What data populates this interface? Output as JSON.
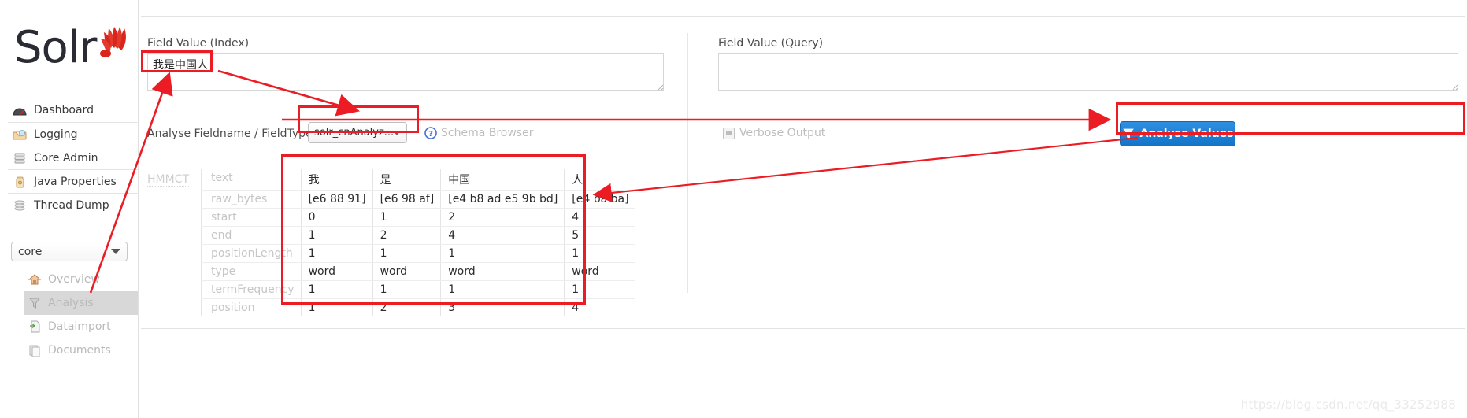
{
  "app": {
    "logo_text": "Solr",
    "watermark": "https://blog.csdn.net/qq_33252988"
  },
  "sidebar": {
    "items": [
      {
        "label": "Dashboard",
        "icon": "dashboard-gauge-icon"
      },
      {
        "label": "Logging",
        "icon": "logging-tray-icon"
      },
      {
        "label": "Core Admin",
        "icon": "core-admin-database-icon"
      },
      {
        "label": "Java Properties",
        "icon": "java-properties-jar-icon"
      },
      {
        "label": "Thread Dump",
        "icon": "thread-dump-stack-icon"
      }
    ],
    "core_selector": {
      "value": "core",
      "icon": "chevron-down-icon"
    },
    "subnav": [
      {
        "label": "Overview",
        "icon": "overview-home-icon",
        "active": false
      },
      {
        "label": "Analysis",
        "icon": "analysis-funnel-icon",
        "active": true
      },
      {
        "label": "Dataimport",
        "icon": "dataimport-page-icon",
        "active": false
      },
      {
        "label": "Documents",
        "icon": "documents-page-icon",
        "active": false
      }
    ]
  },
  "main": {
    "field_index": {
      "label": "Field Value (Index)",
      "value": "我是中国人",
      "placeholder": ""
    },
    "field_query": {
      "label": "Field Value (Query)",
      "value": "",
      "placeholder": ""
    },
    "analyse_row": {
      "label": "Analyse Fieldname / FieldType:",
      "fieldtype_value": "solr_cnAnalyz...",
      "schema_browser_label": "Schema Browser",
      "schema_browser_icon": "question-mark-icon",
      "verbose_output_label": "Verbose Output",
      "verbose_output_checked": true,
      "analyse_button_label": "Analyse Values",
      "analyse_button_icon": "funnel-icon",
      "analyse_button_color": "#1275c8"
    },
    "results": {
      "analyzer_name": "HMMCT",
      "row_labels": [
        "text",
        "raw_bytes",
        "start",
        "end",
        "positionLength",
        "type",
        "termFrequency",
        "position"
      ],
      "tokens": [
        {
          "text": "我",
          "raw_bytes": "[e6 88 91]",
          "start": "0",
          "end": "1",
          "positionLength": "1",
          "type": "word",
          "termFrequency": "1",
          "position": "1"
        },
        {
          "text": "是",
          "raw_bytes": "[e6 98 af]",
          "start": "1",
          "end": "2",
          "positionLength": "1",
          "type": "word",
          "termFrequency": "1",
          "position": "2"
        },
        {
          "text": "中国",
          "raw_bytes": "[e4 b8 ad e5 9b bd]",
          "start": "2",
          "end": "4",
          "positionLength": "1",
          "type": "word",
          "termFrequency": "1",
          "position": "3"
        },
        {
          "text": "人",
          "raw_bytes": "[e4 ba ba]",
          "start": "4",
          "end": "5",
          "positionLength": "1",
          "type": "word",
          "termFrequency": "1",
          "position": "4"
        }
      ]
    }
  },
  "annotations": {
    "color": "#ec1c24"
  }
}
